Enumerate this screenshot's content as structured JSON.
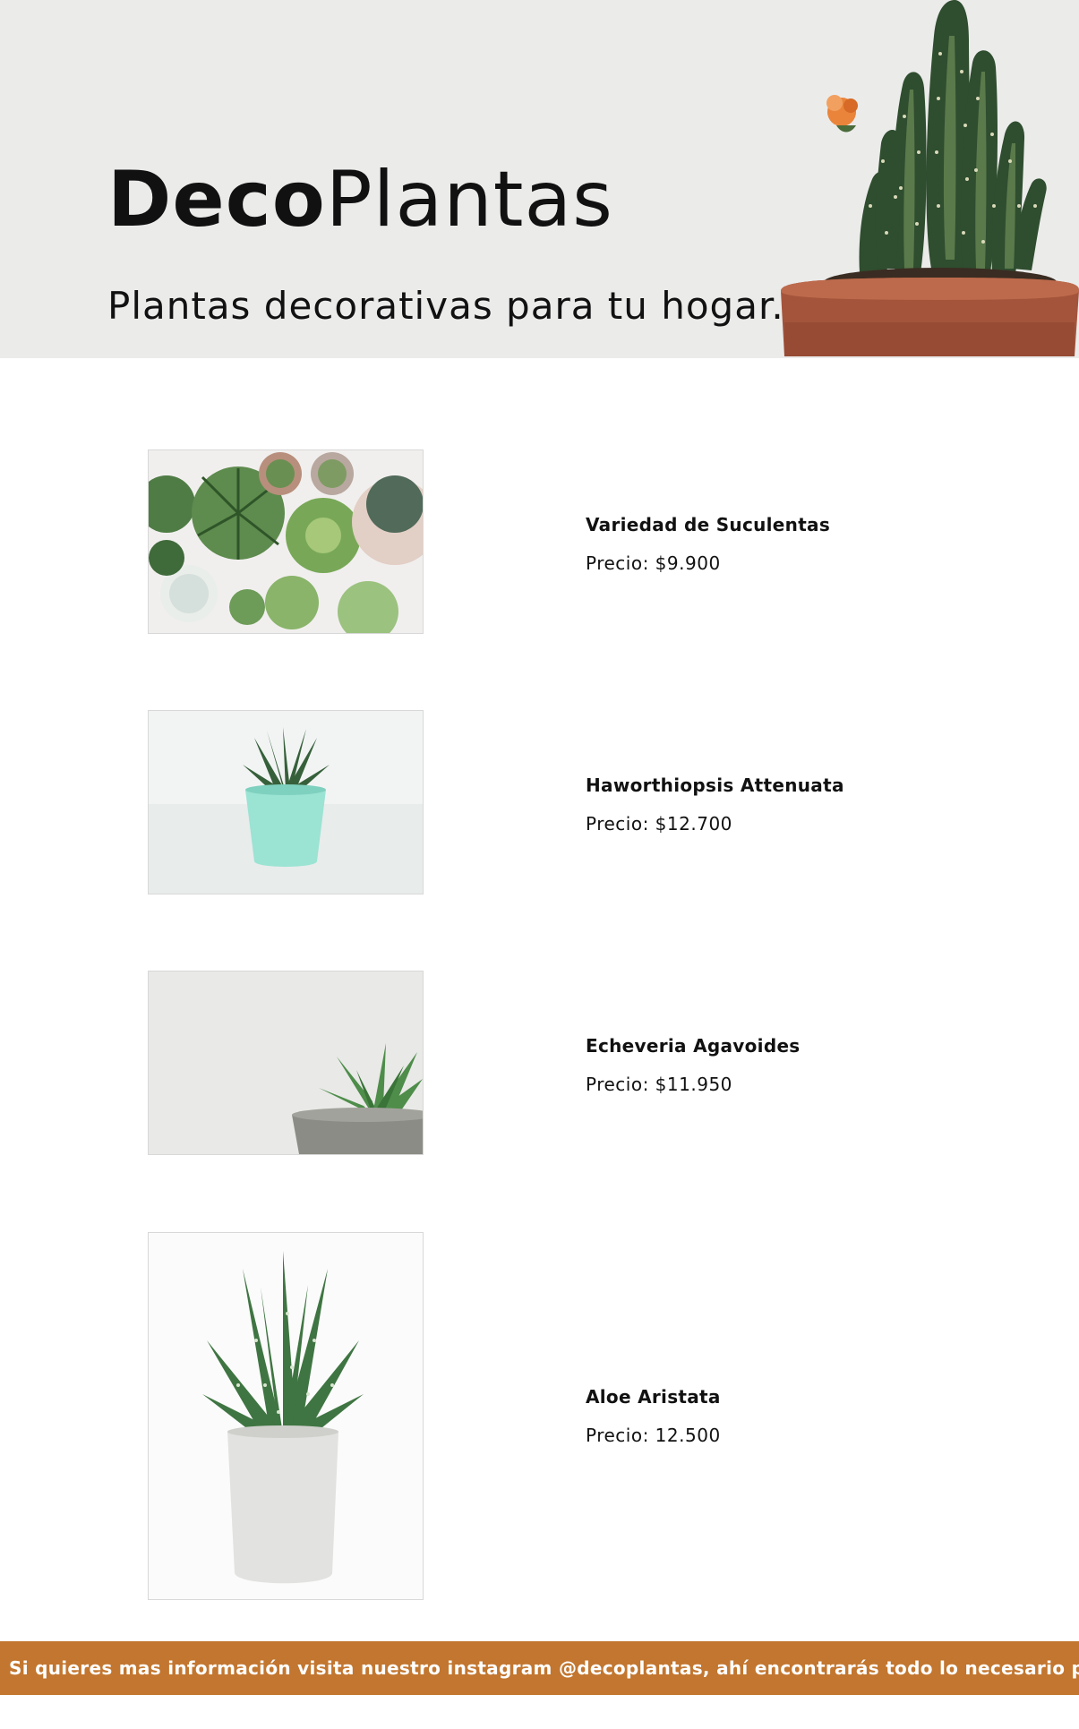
{
  "header": {
    "brand_bold": "Deco",
    "brand_regular": "Plantas",
    "tagline": "Plantas decorativas para tu hogar."
  },
  "colors": {
    "hero_bg": "#ebebea",
    "footer_bg": "#c2762f",
    "text": "#111111"
  },
  "products": [
    {
      "name": "Variedad de Suculentas",
      "price": "Precio: $9.900",
      "image_icon": "succulents-variety-image"
    },
    {
      "name": "Haworthiopsis Attenuata",
      "price": "Precio: $12.700",
      "image_icon": "haworthiopsis-image"
    },
    {
      "name": "Echeveria Agavoides",
      "price": "Precio: $11.950",
      "image_icon": "echeveria-image"
    },
    {
      "name": "Aloe Aristata",
      "price": "Precio: 12.500",
      "image_icon": "aloe-image"
    }
  ],
  "footer": {
    "text": "Si quieres mas información visita nuestro instagram @decoplantas, ahí encontrarás todo lo necesario para el cuidad"
  }
}
